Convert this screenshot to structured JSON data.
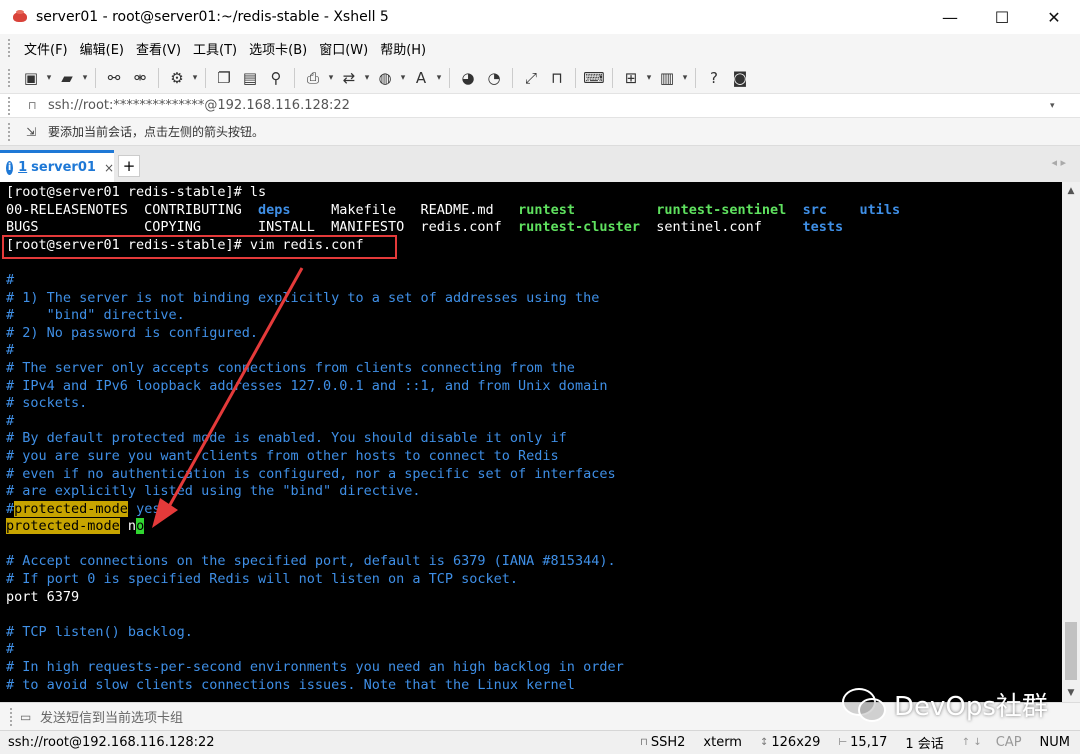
{
  "window": {
    "title": "server01 - root@server01:~/redis-stable - Xshell 5",
    "controls": {
      "minimize": "—",
      "maximize": "☐",
      "close": "✕"
    }
  },
  "menu": {
    "items": [
      "文件(F)",
      "编辑(E)",
      "查看(V)",
      "工具(T)",
      "选项卡(B)",
      "窗口(W)",
      "帮助(H)"
    ]
  },
  "address": {
    "text": "ssh://root:**************@192.168.116.128:22",
    "caret": "▾"
  },
  "hint": {
    "text": "要添加当前会话，点击左侧的箭头按钮。"
  },
  "tabs": {
    "items": [
      {
        "number": "1",
        "label": "server01",
        "close": "×"
      }
    ],
    "add": "+",
    "nav": "◂ ▸"
  },
  "terminal": {
    "lines": [
      [
        {
          "t": "[root@server01 redis-stable]# ls",
          "c": "c-white"
        }
      ],
      [
        {
          "t": "00-RELEASENOTES  CONTRIBUTING  ",
          "c": "c-white"
        },
        {
          "t": "deps",
          "c": "c-bblue"
        },
        {
          "t": "     Makefile   README.md   ",
          "c": "c-white"
        },
        {
          "t": "runtest",
          "c": "c-green"
        },
        {
          "t": "          ",
          "c": "c-white"
        },
        {
          "t": "runtest-sentinel",
          "c": "c-green"
        },
        {
          "t": "  ",
          "c": "c-white"
        },
        {
          "t": "src",
          "c": "c-bblue"
        },
        {
          "t": "    ",
          "c": "c-white"
        },
        {
          "t": "utils",
          "c": "c-bblue"
        }
      ],
      [
        {
          "t": "BUGS             COPYING       INSTALL  MANIFESTO  redis.conf  ",
          "c": "c-white"
        },
        {
          "t": "runtest-cluster",
          "c": "c-green"
        },
        {
          "t": "  sentinel.conf     ",
          "c": "c-white"
        },
        {
          "t": "tests",
          "c": "c-bblue"
        }
      ],
      [
        {
          "t": "[root@server01 redis-stable]# vim redis.conf",
          "c": "c-white"
        }
      ],
      [
        {
          "t": "",
          "c": "c-white"
        }
      ],
      [
        {
          "t": "#",
          "c": "c-blue"
        }
      ],
      [
        {
          "t": "# 1) The server is not binding explicitly to a set of addresses using the",
          "c": "c-blue"
        }
      ],
      [
        {
          "t": "#    \"bind\" directive.",
          "c": "c-blue"
        }
      ],
      [
        {
          "t": "# 2) No password is configured.",
          "c": "c-blue"
        }
      ],
      [
        {
          "t": "#",
          "c": "c-blue"
        }
      ],
      [
        {
          "t": "# The server only accepts connections from clients connecting from the",
          "c": "c-blue"
        }
      ],
      [
        {
          "t": "# IPv4 and IPv6 loopback addresses 127.0.0.1 and ::1, and from Unix domain",
          "c": "c-blue"
        }
      ],
      [
        {
          "t": "# sockets.",
          "c": "c-blue"
        }
      ],
      [
        {
          "t": "#",
          "c": "c-blue"
        }
      ],
      [
        {
          "t": "# By default protected mode is enabled. You should disable it only if",
          "c": "c-blue"
        }
      ],
      [
        {
          "t": "# you are sure you want clients from other hosts to connect to Redis",
          "c": "c-blue"
        }
      ],
      [
        {
          "t": "# even if no authentication is configured, nor a specific set of interfaces",
          "c": "c-blue"
        }
      ],
      [
        {
          "t": "# are explicitly listed using the \"bind\" directive.",
          "c": "c-blue"
        }
      ],
      [
        {
          "t": "#",
          "c": "c-blue"
        },
        {
          "t": "protected-mode",
          "c": "hl"
        },
        {
          "t": " yes",
          "c": "c-blue"
        }
      ],
      [
        {
          "t": "protected-mode",
          "c": "hl"
        },
        {
          "t": " n",
          "c": "c-white"
        },
        {
          "t": "o",
          "c": "cursor"
        }
      ],
      [
        {
          "t": "",
          "c": "c-white"
        }
      ],
      [
        {
          "t": "# Accept connections on the specified port, default is 6379 (IANA #815344).",
          "c": "c-blue"
        }
      ],
      [
        {
          "t": "# If port 0 is specified Redis will not listen on a TCP socket.",
          "c": "c-blue"
        }
      ],
      [
        {
          "t": "port 6379",
          "c": "c-white"
        }
      ],
      [
        {
          "t": "",
          "c": "c-white"
        }
      ],
      [
        {
          "t": "# TCP listen() backlog.",
          "c": "c-blue"
        }
      ],
      [
        {
          "t": "#",
          "c": "c-blue"
        }
      ],
      [
        {
          "t": "# In high requests-per-second environments you need an high backlog in order",
          "c": "c-blue"
        }
      ],
      [
        {
          "t": "# to avoid slow clients connections issues. Note that the Linux kernel",
          "c": "c-blue"
        }
      ]
    ]
  },
  "compose": {
    "text": "发送短信到当前选项卡组"
  },
  "watermark": {
    "text": "DevOps社群"
  },
  "status": {
    "address": "ssh://root@192.168.116.128:22",
    "protocol": "SSH2",
    "term": "xterm",
    "size": "126x29",
    "cursor": "15,17",
    "sessions": "1 会话",
    "cap": "CAP",
    "num": "NUM"
  },
  "colors": {
    "accent": "#1e78d6",
    "annotation_red": "#e43a3a",
    "highlight": "#c7a400",
    "cursor": "#31d631"
  }
}
